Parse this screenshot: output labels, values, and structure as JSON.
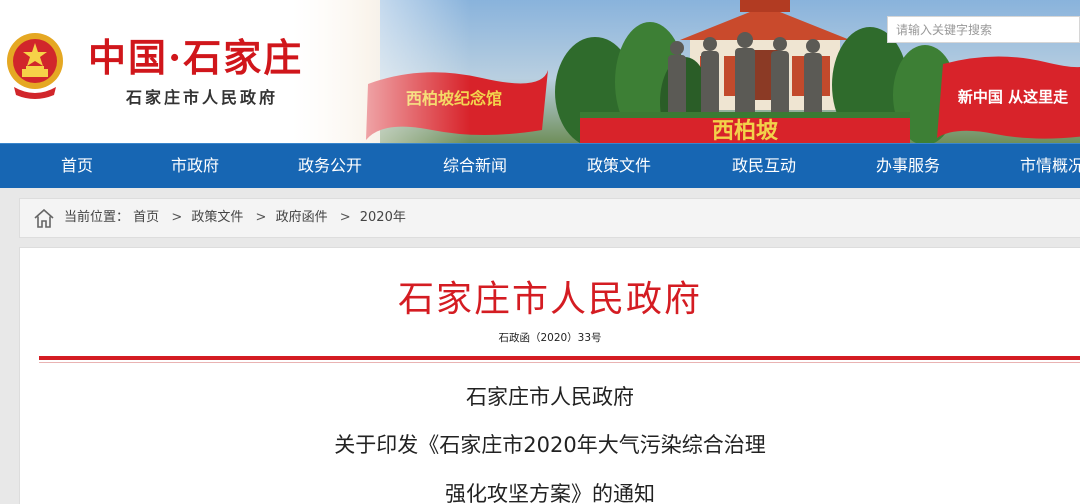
{
  "header": {
    "site_title": "中国·石家庄",
    "site_subtitle": "石家庄市人民政府",
    "search_placeholder": "请输入关键字搜索",
    "banner_left_flag": "西柏坡纪念馆",
    "banner_right_flag": "新中国 从这里走",
    "banner_sign": "西柏坡",
    "colors": {
      "brand_red": "#d0161b",
      "nav_blue": "#1766b3"
    }
  },
  "nav": {
    "items": [
      "首页",
      "市政府",
      "政务公开",
      "综合新闻",
      "政策文件",
      "政民互动",
      "办事服务",
      "市情概况"
    ]
  },
  "breadcrumb": {
    "icon": "home-icon",
    "label": "当前位置：",
    "items": [
      "首页",
      "政策文件",
      "政府函件",
      "2020年"
    ],
    "separator": ">"
  },
  "document": {
    "issuer": "石家庄市人民政府",
    "number": "石政函（2020）33号",
    "title_lines": [
      "石家庄市人民政府",
      "关于印发《石家庄市2020年大气污染综合治理",
      "强化攻坚方案》的通知"
    ]
  }
}
